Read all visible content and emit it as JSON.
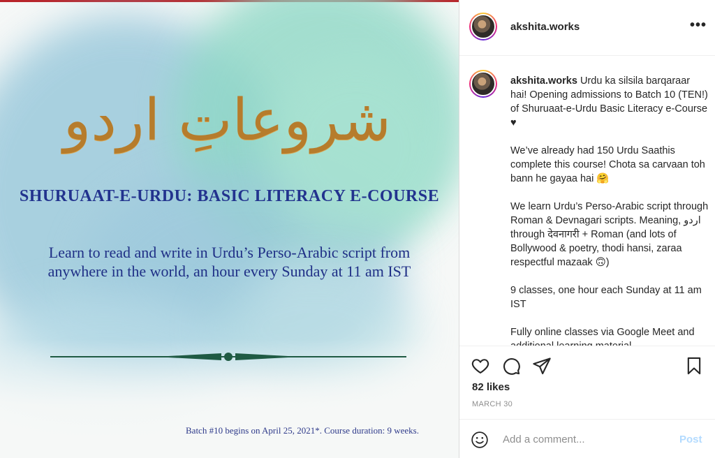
{
  "post_image": {
    "urdu_title": "شروعاتِ اردو",
    "course_title": "SHURUAAT-E-URDU: BASIC LITERACY E-COURSE",
    "description": "Learn to read and write in Urdu’s Perso-Arabic script from anywhere in the world, an hour every Sunday at 11 am IST",
    "batch_note": "Batch #10 begins on April 25, 2021*. Course duration: 9 weeks.",
    "title_color": "#b67c2c",
    "text_color": "#22338e"
  },
  "header": {
    "username": "akshita.works",
    "more_icon": "more-horizontal-icon"
  },
  "caption": {
    "username": "akshita.works",
    "paragraphs": [
      "Urdu ka silsila barqaraar hai! Opening admissions to Batch 10 (TEN!) of Shuruaat-e-Urdu Basic Literacy e-Course ♥",
      "We’ve already had 150 Urdu Saathis complete this course! Chota sa carvaan toh bann he gayaa hai 🤗",
      "We learn Urdu’s Perso-Arabic script through Roman & Devnagari scripts. Meaning, اردو through देवनागरी + Roman (and lots of Bollywood & poetry, thodi hansi, zaraa respectful mazaak 🙃)",
      "9 classes, one hour each Sunday at 11 am IST",
      "Fully online classes via Google Meet and additional learning material"
    ]
  },
  "actions": {
    "likes": "82 likes",
    "date": "MARCH 30",
    "icons": [
      "heart-icon",
      "comment-icon",
      "share-icon",
      "bookmark-icon"
    ]
  },
  "comment": {
    "placeholder": "Add a comment...",
    "post_label": "Post"
  }
}
